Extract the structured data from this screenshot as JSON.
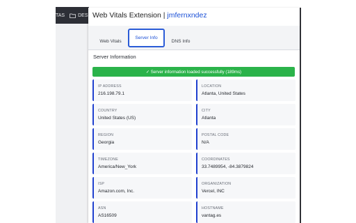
{
  "browser": {
    "bookmark_1": "TAS",
    "bookmark_2": "DES"
  },
  "popup": {
    "title": "Web Vitals Extension |",
    "username": "jmfernxndez",
    "tabs": [
      {
        "label": "Web Vitals"
      },
      {
        "label": "Server Info"
      },
      {
        "label": "DNS Info"
      }
    ],
    "section_title": "Server Information",
    "status_message": "✓ Server information loaded successfully (189ms)",
    "fields": [
      {
        "label": "IP ADDRESS",
        "value": "216.198.79.1"
      },
      {
        "label": "LOCATION",
        "value": "Atlanta, United States"
      },
      {
        "label": "COUNTRY",
        "value": "United States (US)"
      },
      {
        "label": "CITY",
        "value": "Atlanta"
      },
      {
        "label": "REGION",
        "value": "Georgia"
      },
      {
        "label": "POSTAL CODE",
        "value": "N/A"
      },
      {
        "label": "TIMEZONE",
        "value": "America/New_York"
      },
      {
        "label": "COORDINATES",
        "value": "33.7489954, -84.3879824"
      },
      {
        "label": "ISP",
        "value": "Amazon.com, Inc."
      },
      {
        "label": "ORGANIZATION",
        "value": "Vercel, INC"
      },
      {
        "label": "ASN",
        "value": "AS16509"
      },
      {
        "label": "HOSTNAME",
        "value": "vantag.es"
      }
    ]
  },
  "colors": {
    "accent": "#1a4fd6",
    "success": "#2bb34a",
    "card_border": "#1f3fcf"
  }
}
